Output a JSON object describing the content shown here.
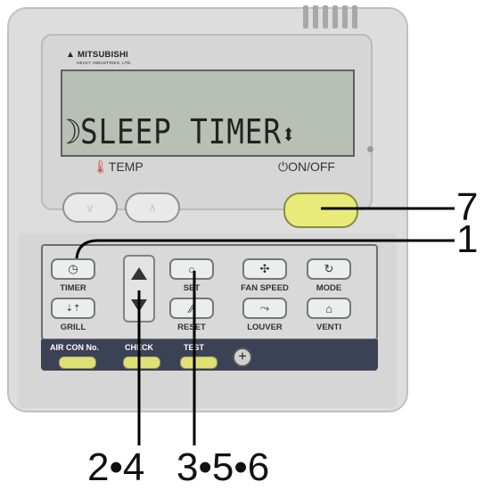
{
  "brand": {
    "name": "MITSUBISHI",
    "subtitle": "HEAVY INDUSTRIES, LTD."
  },
  "display": {
    "text": "SLEEP TIMER"
  },
  "labels": {
    "temp": "TEMP",
    "onoff": "ON/OFF"
  },
  "buttons": {
    "timer": "TIMER",
    "set": "SET",
    "fan_speed": "FAN SPEED",
    "mode": "MODE",
    "grill": "GRILL",
    "reset": "RESET",
    "louver": "LOUVER",
    "venti": "VENTI",
    "air_con_no": "AIR CON No.",
    "check": "CHECK",
    "test": "TEST"
  },
  "callouts": {
    "c7": "7",
    "c1": "1",
    "c24": "2•4",
    "c356": "3•5•6"
  },
  "colors": {
    "body": "#dcdddc",
    "lcd": "#b8bfb5",
    "onoff_button": "#e8ea7a",
    "bottom_strip": "#3c4255"
  }
}
